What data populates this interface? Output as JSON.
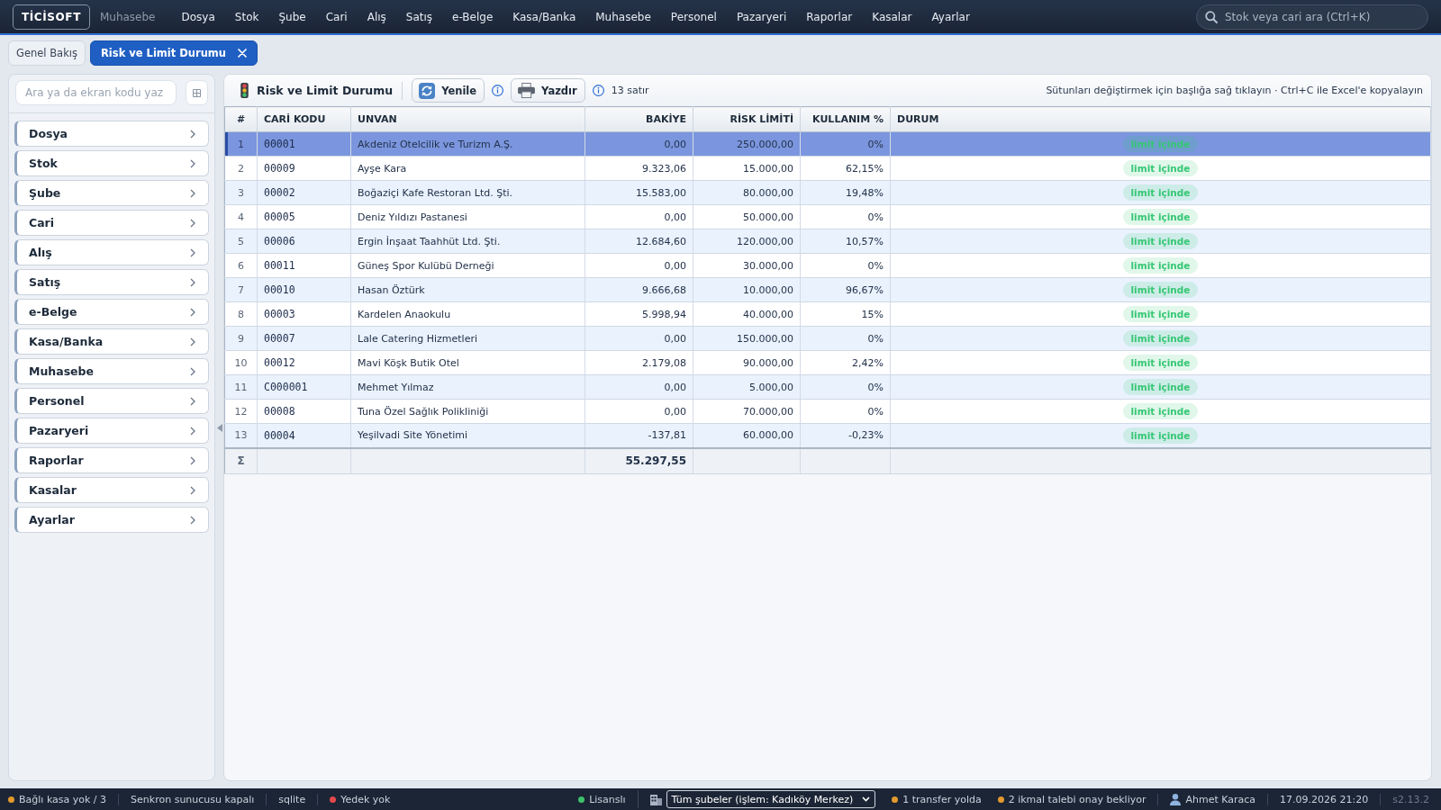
{
  "top_bar": {
    "logo": "TİCİSOFT",
    "module": "Muhasebe",
    "menu": [
      "Dosya",
      "Stok",
      "Şube",
      "Cari",
      "Alış",
      "Satış",
      "e-Belge",
      "Kasa/Banka",
      "Muhasebe",
      "Personel",
      "Pazaryeri",
      "Raporlar",
      "Kasalar",
      "Ayarlar"
    ],
    "search": {
      "placeholder": "Stok veya cari ara (Ctrl+K)"
    }
  },
  "tabs": [
    {
      "label": "Genel Bakış",
      "selected": false,
      "closable": false
    },
    {
      "label": "Risk ve Limit Durumu",
      "selected": true,
      "closable": true
    }
  ],
  "sidebar": {
    "search": {
      "placeholder": "Ara ya da ekran kodu yaz"
    },
    "items": [
      "Dosya",
      "Stok",
      "Şube",
      "Cari",
      "Alış",
      "Satış",
      "e-Belge",
      "Kasa/Banka",
      "Muhasebe",
      "Personel",
      "Pazaryeri",
      "Raporlar",
      "Kasalar",
      "Ayarlar"
    ]
  },
  "toolbar": {
    "title": "Risk ve Limit Durumu",
    "buttons": [
      {
        "kind": "refresh",
        "label": "Yenile"
      },
      {
        "kind": "print",
        "label": "Yazdır"
      }
    ],
    "row_count": "13 satır",
    "hint": "Sütunları değiştirmek için başlığa sağ tıklayın · Ctrl+C ile Excel'e kopyalayın"
  },
  "table": {
    "columns": [
      {
        "label": "#",
        "kind": "index"
      },
      {
        "label": "CARİ KODU",
        "kind": "code"
      },
      {
        "label": "UNVAN",
        "kind": "text"
      },
      {
        "label": "BAKİYE",
        "kind": "number"
      },
      {
        "label": "RİSK LİMİTİ",
        "kind": "number"
      },
      {
        "label": "KULLANIM %",
        "kind": "number"
      },
      {
        "label": "DURUM",
        "kind": "status"
      }
    ],
    "rows": [
      {
        "selected": true,
        "cells": [
          "1",
          "00001",
          "Akdeniz Otelcilik ve Turizm A.Ş.",
          "0,00",
          "250.000,00",
          "0%",
          "limit içinde"
        ]
      },
      {
        "selected": false,
        "cells": [
          "2",
          "00009",
          "Ayşe Kara",
          "9.323,06",
          "15.000,00",
          "62,15%",
          "limit içinde"
        ]
      },
      {
        "selected": false,
        "cells": [
          "3",
          "00002",
          "Boğaziçi Kafe Restoran Ltd. Şti.",
          "15.583,00",
          "80.000,00",
          "19,48%",
          "limit içinde"
        ]
      },
      {
        "selected": false,
        "cells": [
          "4",
          "00005",
          "Deniz Yıldızı Pastanesi",
          "0,00",
          "50.000,00",
          "0%",
          "limit içinde"
        ]
      },
      {
        "selected": false,
        "cells": [
          "5",
          "00006",
          "Ergin İnşaat Taahhüt Ltd. Şti.",
          "12.684,60",
          "120.000,00",
          "10,57%",
          "limit içinde"
        ]
      },
      {
        "selected": false,
        "cells": [
          "6",
          "00011",
          "Güneş Spor Kulübü Derneği",
          "0,00",
          "30.000,00",
          "0%",
          "limit içinde"
        ]
      },
      {
        "selected": false,
        "cells": [
          "7",
          "00010",
          "Hasan Öztürk",
          "9.666,68",
          "10.000,00",
          "96,67%",
          "limit içinde"
        ]
      },
      {
        "selected": false,
        "cells": [
          "8",
          "00003",
          "Kardelen Anaokulu",
          "5.998,94",
          "40.000,00",
          "15%",
          "limit içinde"
        ]
      },
      {
        "selected": false,
        "cells": [
          "9",
          "00007",
          "Lale Catering Hizmetleri",
          "0,00",
          "150.000,00",
          "0%",
          "limit içinde"
        ]
      },
      {
        "selected": false,
        "cells": [
          "10",
          "00012",
          "Mavi Köşk Butik Otel",
          "2.179,08",
          "90.000,00",
          "2,42%",
          "limit içinde"
        ]
      },
      {
        "selected": false,
        "cells": [
          "11",
          "C000001",
          "Mehmet Yılmaz",
          "0,00",
          "5.000,00",
          "0%",
          "limit içinde"
        ]
      },
      {
        "selected": false,
        "cells": [
          "12",
          "00008",
          "Tuna Özel Sağlık Polikliniği",
          "0,00",
          "70.000,00",
          "0%",
          "limit içinde"
        ]
      },
      {
        "selected": false,
        "cells": [
          "13",
          "00004",
          "Yeşilvadi Site Yönetimi",
          "-137,81",
          "60.000,00",
          "-0,23%",
          "limit içinde"
        ]
      }
    ],
    "footer": {
      "label": "Σ",
      "total": "55.297,55"
    }
  },
  "status_bar": {
    "left": [
      {
        "items": [
          {
            "kind": "dot",
            "label": "Bağlı kasa yok / 3",
            "color": "#e39b2d"
          }
        ]
      },
      {
        "items": [
          {
            "kind": "text",
            "label": "Senkron sunucusu kapalı"
          }
        ]
      },
      {
        "items": [
          {
            "kind": "text",
            "label": "sqlite"
          }
        ]
      },
      {
        "items": [
          {
            "kind": "dot",
            "label": "Yedek yok",
            "color": "#e5484d"
          }
        ]
      }
    ],
    "right": [
      {
        "items": [
          {
            "kind": "dot",
            "label": "Lisanslı",
            "color": "#3ec26b"
          }
        ]
      },
      {
        "items": [
          {
            "kind": "branch",
            "value": "Tüm şubeler (işlem: Kadıköy Merkez)"
          },
          {
            "kind": "dot",
            "label": "1 transfer yolda",
            "color": "#e39b2d"
          },
          {
            "kind": "dot",
            "label": "2 ikmal talebi onay bekliyor",
            "color": "#e39b2d"
          }
        ]
      },
      {
        "items": [
          {
            "kind": "user",
            "label": "Ahmet Karaca"
          }
        ]
      },
      {
        "items": [
          {
            "kind": "text",
            "label": "17.09.2026 21:20"
          }
        ]
      },
      {
        "items": [
          {
            "kind": "version",
            "label": "s2.13.2"
          }
        ]
      }
    ]
  }
}
